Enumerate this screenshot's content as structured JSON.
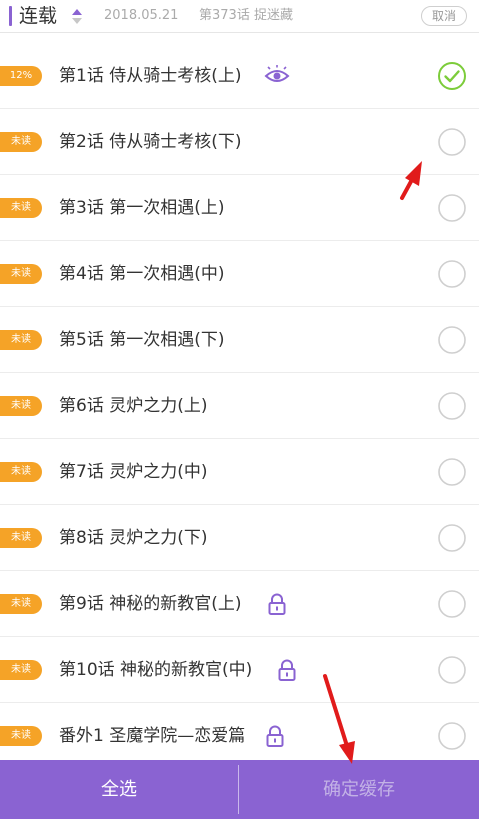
{
  "header": {
    "title": "连载",
    "date": "2018.05.21",
    "latest": "第373话 捉迷藏",
    "cancel_label": "取消"
  },
  "chapters": [
    {
      "badge": "12%",
      "name": "第1话 侍从骑士考核(上)",
      "icon": "eye-icon",
      "checked": true
    },
    {
      "badge": "未读",
      "name": "第2话 侍从骑士考核(下)",
      "icon": "",
      "checked": false
    },
    {
      "badge": "未读",
      "name": "第3话 第一次相遇(上)",
      "icon": "",
      "checked": false
    },
    {
      "badge": "未读",
      "name": "第4话 第一次相遇(中)",
      "icon": "",
      "checked": false
    },
    {
      "badge": "未读",
      "name": "第5话 第一次相遇(下)",
      "icon": "",
      "checked": false
    },
    {
      "badge": "未读",
      "name": "第6话 灵炉之力(上)",
      "icon": "",
      "checked": false
    },
    {
      "badge": "未读",
      "name": "第7话 灵炉之力(中)",
      "icon": "",
      "checked": false
    },
    {
      "badge": "未读",
      "name": "第8话 灵炉之力(下)",
      "icon": "",
      "checked": false
    },
    {
      "badge": "未读",
      "name": "第9话 神秘的新教官(上)",
      "icon": "lock-icon",
      "checked": false
    },
    {
      "badge": "未读",
      "name": "第10话 神秘的新教官(中)",
      "icon": "lock-icon",
      "checked": false
    },
    {
      "badge": "未读",
      "name": "番外1 圣魔学院—恋爱篇",
      "icon": "lock-icon",
      "checked": false
    }
  ],
  "bottom": {
    "select_all_label": "全选",
    "confirm_label": "确定缓存"
  },
  "colors": {
    "accent": "#8a63d2",
    "badge": "#f5a327",
    "check": "#7ccc3a",
    "annotation_arrow": "#e11b1b"
  }
}
